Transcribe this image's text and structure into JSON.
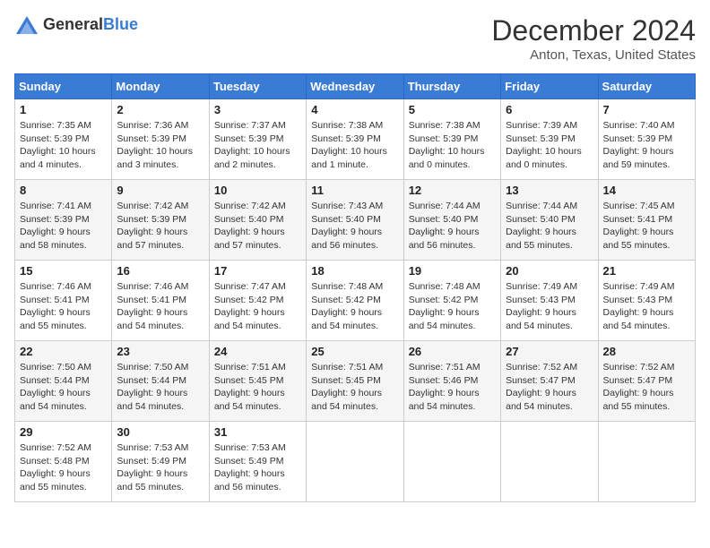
{
  "logo": {
    "general": "General",
    "blue": "Blue"
  },
  "title": "December 2024",
  "location": "Anton, Texas, United States",
  "weekdays": [
    "Sunday",
    "Monday",
    "Tuesday",
    "Wednesday",
    "Thursday",
    "Friday",
    "Saturday"
  ],
  "weeks": [
    [
      {
        "day": "1",
        "sunrise": "7:35 AM",
        "sunset": "5:39 PM",
        "daylight": "10 hours and 4 minutes."
      },
      {
        "day": "2",
        "sunrise": "7:36 AM",
        "sunset": "5:39 PM",
        "daylight": "10 hours and 3 minutes."
      },
      {
        "day": "3",
        "sunrise": "7:37 AM",
        "sunset": "5:39 PM",
        "daylight": "10 hours and 2 minutes."
      },
      {
        "day": "4",
        "sunrise": "7:38 AM",
        "sunset": "5:39 PM",
        "daylight": "10 hours and 1 minute."
      },
      {
        "day": "5",
        "sunrise": "7:38 AM",
        "sunset": "5:39 PM",
        "daylight": "10 hours and 0 minutes."
      },
      {
        "day": "6",
        "sunrise": "7:39 AM",
        "sunset": "5:39 PM",
        "daylight": "10 hours and 0 minutes."
      },
      {
        "day": "7",
        "sunrise": "7:40 AM",
        "sunset": "5:39 PM",
        "daylight": "9 hours and 59 minutes."
      }
    ],
    [
      {
        "day": "8",
        "sunrise": "7:41 AM",
        "sunset": "5:39 PM",
        "daylight": "9 hours and 58 minutes."
      },
      {
        "day": "9",
        "sunrise": "7:42 AM",
        "sunset": "5:39 PM",
        "daylight": "9 hours and 57 minutes."
      },
      {
        "day": "10",
        "sunrise": "7:42 AM",
        "sunset": "5:40 PM",
        "daylight": "9 hours and 57 minutes."
      },
      {
        "day": "11",
        "sunrise": "7:43 AM",
        "sunset": "5:40 PM",
        "daylight": "9 hours and 56 minutes."
      },
      {
        "day": "12",
        "sunrise": "7:44 AM",
        "sunset": "5:40 PM",
        "daylight": "9 hours and 56 minutes."
      },
      {
        "day": "13",
        "sunrise": "7:44 AM",
        "sunset": "5:40 PM",
        "daylight": "9 hours and 55 minutes."
      },
      {
        "day": "14",
        "sunrise": "7:45 AM",
        "sunset": "5:41 PM",
        "daylight": "9 hours and 55 minutes."
      }
    ],
    [
      {
        "day": "15",
        "sunrise": "7:46 AM",
        "sunset": "5:41 PM",
        "daylight": "9 hours and 55 minutes."
      },
      {
        "day": "16",
        "sunrise": "7:46 AM",
        "sunset": "5:41 PM",
        "daylight": "9 hours and 54 minutes."
      },
      {
        "day": "17",
        "sunrise": "7:47 AM",
        "sunset": "5:42 PM",
        "daylight": "9 hours and 54 minutes."
      },
      {
        "day": "18",
        "sunrise": "7:48 AM",
        "sunset": "5:42 PM",
        "daylight": "9 hours and 54 minutes."
      },
      {
        "day": "19",
        "sunrise": "7:48 AM",
        "sunset": "5:42 PM",
        "daylight": "9 hours and 54 minutes."
      },
      {
        "day": "20",
        "sunrise": "7:49 AM",
        "sunset": "5:43 PM",
        "daylight": "9 hours and 54 minutes."
      },
      {
        "day": "21",
        "sunrise": "7:49 AM",
        "sunset": "5:43 PM",
        "daylight": "9 hours and 54 minutes."
      }
    ],
    [
      {
        "day": "22",
        "sunrise": "7:50 AM",
        "sunset": "5:44 PM",
        "daylight": "9 hours and 54 minutes."
      },
      {
        "day": "23",
        "sunrise": "7:50 AM",
        "sunset": "5:44 PM",
        "daylight": "9 hours and 54 minutes."
      },
      {
        "day": "24",
        "sunrise": "7:51 AM",
        "sunset": "5:45 PM",
        "daylight": "9 hours and 54 minutes."
      },
      {
        "day": "25",
        "sunrise": "7:51 AM",
        "sunset": "5:45 PM",
        "daylight": "9 hours and 54 minutes."
      },
      {
        "day": "26",
        "sunrise": "7:51 AM",
        "sunset": "5:46 PM",
        "daylight": "9 hours and 54 minutes."
      },
      {
        "day": "27",
        "sunrise": "7:52 AM",
        "sunset": "5:47 PM",
        "daylight": "9 hours and 54 minutes."
      },
      {
        "day": "28",
        "sunrise": "7:52 AM",
        "sunset": "5:47 PM",
        "daylight": "9 hours and 55 minutes."
      }
    ],
    [
      {
        "day": "29",
        "sunrise": "7:52 AM",
        "sunset": "5:48 PM",
        "daylight": "9 hours and 55 minutes."
      },
      {
        "day": "30",
        "sunrise": "7:53 AM",
        "sunset": "5:49 PM",
        "daylight": "9 hours and 55 minutes."
      },
      {
        "day": "31",
        "sunrise": "7:53 AM",
        "sunset": "5:49 PM",
        "daylight": "9 hours and 56 minutes."
      },
      null,
      null,
      null,
      null
    ]
  ],
  "labels": {
    "sunrise": "Sunrise:",
    "sunset": "Sunset:",
    "daylight": "Daylight:"
  }
}
